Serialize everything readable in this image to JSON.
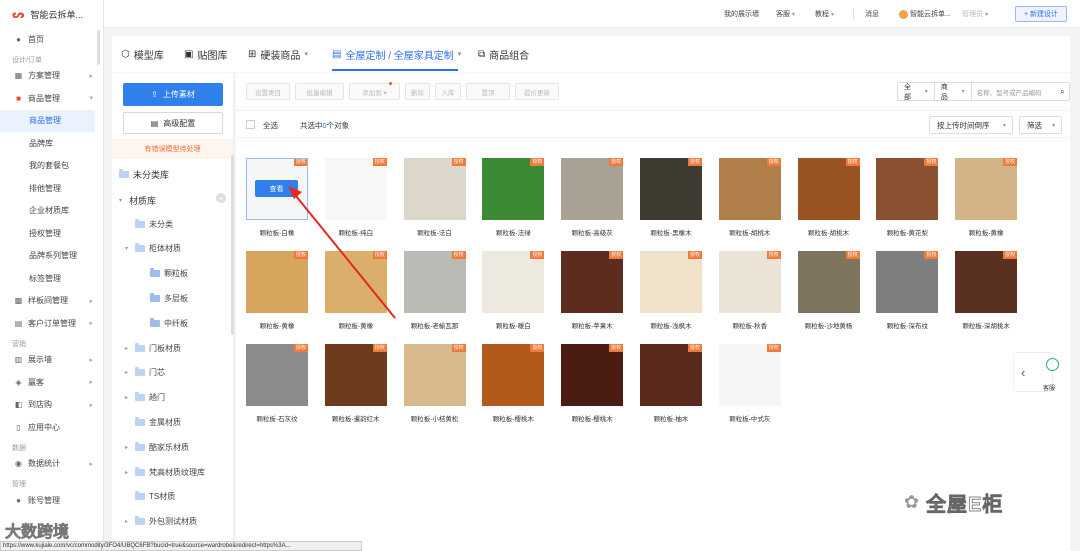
{
  "app": {
    "logo_mark": "ᔕ",
    "logo_text": "智能云拆单..."
  },
  "leftnav": {
    "home": "首页",
    "section_design": "设计/订单",
    "scheme": "方案管理",
    "product": "商品管理",
    "product_sub": [
      "商品管理",
      "品牌库",
      "我的套餐包",
      "排他管理",
      "企业材质库",
      "授权管理",
      "品牌系列管理",
      "标签管理"
    ],
    "sample": "样板间管理",
    "customer_order": "客户订单管理",
    "section_marketing": "营销",
    "showroom": "展示墙",
    "coupon": "赢客",
    "purchase": "到店购",
    "app_center": "应用中心",
    "section_data": "数据",
    "data_stats": "数据统计",
    "section_manage": "管理",
    "account": "账号管理"
  },
  "topbar": {
    "showroom": "我的展示墙",
    "service": "客服",
    "tutorial": "教程",
    "message": "消息",
    "user": "智能云拆单...",
    "role": "管理员",
    "new_design": "+ 新建设计"
  },
  "tabs": [
    {
      "icon": "⬡",
      "label": "模型库"
    },
    {
      "icon": "▣",
      "label": "贴图库"
    },
    {
      "icon": "⊞",
      "label": "硬装商品"
    },
    {
      "icon": "▤",
      "label": "全屋定制 / 全屋家具定制"
    },
    {
      "icon": "⧉",
      "label": "商品组合"
    }
  ],
  "catpanel": {
    "upload": "上传素材",
    "config": "高级配置",
    "warning": "有错误模型待处理",
    "uncategorized_root": "未分类库",
    "material_root": "材质库",
    "tree": [
      {
        "label": "未分类",
        "level": 1,
        "caret": ""
      },
      {
        "label": "柜体材质",
        "level": 1,
        "caret": "▾"
      },
      {
        "label": "颗粒板",
        "level": 2,
        "caret": ""
      },
      {
        "label": "多层板",
        "level": 2,
        "caret": ""
      },
      {
        "label": "中纤板",
        "level": 2,
        "caret": ""
      },
      {
        "label": "门板材质",
        "level": 1,
        "caret": "▸"
      },
      {
        "label": "门芯",
        "level": 1,
        "caret": "▸"
      },
      {
        "label": "趟门",
        "level": 1,
        "caret": "▸"
      },
      {
        "label": "金属材质",
        "level": 1,
        "caret": ""
      },
      {
        "label": "酷家乐材质",
        "level": 1,
        "caret": "▸"
      },
      {
        "label": "梵高材质纹理库",
        "level": 1,
        "caret": "▸"
      },
      {
        "label": "TS材质",
        "level": 1,
        "caret": ""
      },
      {
        "label": "外包测试材质",
        "level": 1,
        "caret": "▸"
      }
    ]
  },
  "toolbar": {
    "buttons": [
      "设置类目",
      "批量编辑",
      "添加到 ▾",
      "删除",
      "入库",
      "置顶",
      "提价更新"
    ],
    "scope": "全部",
    "field": "商品",
    "search_placeholder": "名称、型号或产品编码",
    "select_all": "全选",
    "selected_prefix": "共选中",
    "selected_count": "0",
    "selected_suffix": "个对象",
    "sort": "按上传时间倒序",
    "filter": "筛选"
  },
  "view_label": "查看",
  "badge": "授权",
  "materials": [
    {
      "name": "颗粒板-白橡",
      "color": "#f4f6f8"
    },
    {
      "name": "颗粒板-纯白",
      "color": "#f7f7f5"
    },
    {
      "name": "颗粒板-法白",
      "color": "#ddd6ca"
    },
    {
      "name": "颗粒板-法绿",
      "color": "#3d8a34"
    },
    {
      "name": "颗粒板-高级灰",
      "color": "#a9a194"
    },
    {
      "name": "颗粒板-黑橡木",
      "color": "#3f3a30"
    },
    {
      "name": "颗粒板-胡桃木",
      "color": "#b07e48"
    },
    {
      "name": "颗粒板-胡桃木",
      "color": "#9a5424"
    },
    {
      "name": "颗粒板-黄花梨",
      "color": "#8a5232"
    },
    {
      "name": "颗粒板-黄橡",
      "color": "#d2b488"
    },
    {
      "name": "颗粒板-黄橡",
      "color": "#d7a65e"
    },
    {
      "name": "颗粒板-黄橡",
      "color": "#dcae6c"
    },
    {
      "name": "颗粒板-老榆瓦那",
      "color": "#bcbab5"
    },
    {
      "name": "颗粒板-暖白",
      "color": "#eee9df"
    },
    {
      "name": "颗粒板-苹果木",
      "color": "#5e2c1e"
    },
    {
      "name": "颗粒板-浅枫木",
      "color": "#efe2c8"
    },
    {
      "name": "颗粒板-秋香",
      "color": "#ebe4d6"
    },
    {
      "name": "颗粒板-沙地黄杨",
      "color": "#7e735c"
    },
    {
      "name": "颗粒板-深布纹",
      "color": "#7e7f80"
    },
    {
      "name": "颗粒板-深胡桃木",
      "color": "#5a3020"
    },
    {
      "name": "颗粒板-石灰纹",
      "color": "#8c8c8c"
    },
    {
      "name": "颗粒板-暹韵红木",
      "color": "#6e3a1e"
    },
    {
      "name": "颗粒板-小桔黄松",
      "color": "#d8b98e"
    },
    {
      "name": "颗粒板-樱桃木",
      "color": "#b15a1c"
    },
    {
      "name": "颗粒板-樱桃木",
      "color": "#4b1d12"
    },
    {
      "name": "颗粒板-柚木",
      "color": "#5a2a1c"
    },
    {
      "name": "颗粒板-中式灰",
      "color": "#f6f6f6"
    }
  ],
  "side_tools": {
    "help_label": "客服"
  },
  "watermarks": {
    "right": "全屋E柜",
    "left": "大数跨境"
  },
  "status_url": "https://www.kujiale.com/vc/commodity/3FO4/UBQC6FB?bucid=true&source=wardrobe&redirect=https%3A..."
}
